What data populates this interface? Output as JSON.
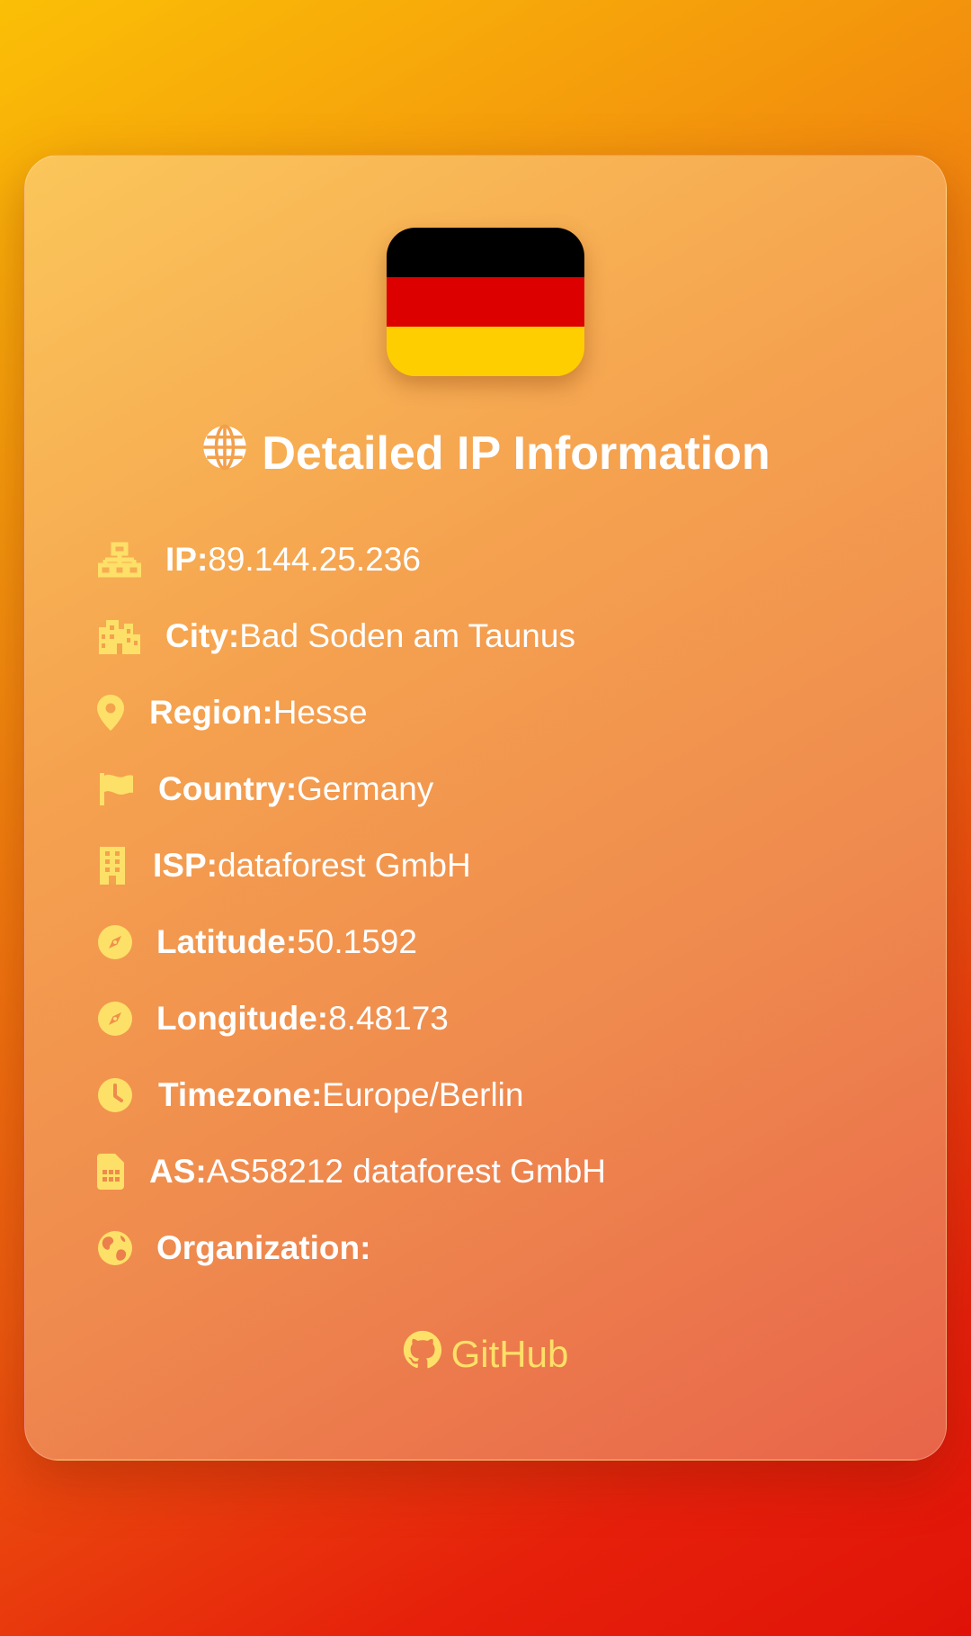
{
  "flag": {
    "country": "Germany",
    "colors": [
      "#000000",
      "#dd0000",
      "#ffce00"
    ]
  },
  "title": {
    "icon": "globe-icon",
    "text": "Detailed IP Information"
  },
  "fields": [
    {
      "icon": "network-icon",
      "label": "IP:",
      "value": "89.144.25.236"
    },
    {
      "icon": "city-icon",
      "label": "City:",
      "value": "Bad Soden am Taunus"
    },
    {
      "icon": "map-pin-icon",
      "label": "Region:",
      "value": "Hesse"
    },
    {
      "icon": "flag-icon",
      "label": "Country:",
      "value": "Germany"
    },
    {
      "icon": "building-icon",
      "label": "ISP:",
      "value": "dataforest GmbH"
    },
    {
      "icon": "compass-icon",
      "label": "Latitude:",
      "value": "50.1592"
    },
    {
      "icon": "compass-icon",
      "label": "Longitude:",
      "value": "8.48173"
    },
    {
      "icon": "clock-icon",
      "label": "Timezone:",
      "value": "Europe/Berlin"
    },
    {
      "icon": "sim-card-icon",
      "label": "AS:",
      "value": "AS58212 dataforest GmbH"
    },
    {
      "icon": "earth-icon",
      "label": "Organization:",
      "value": ""
    }
  ],
  "footer": {
    "link_label": "GitHub",
    "icon": "github-icon"
  },
  "colors": {
    "icon_yellow": "#fde068",
    "text": "#ffffff"
  }
}
